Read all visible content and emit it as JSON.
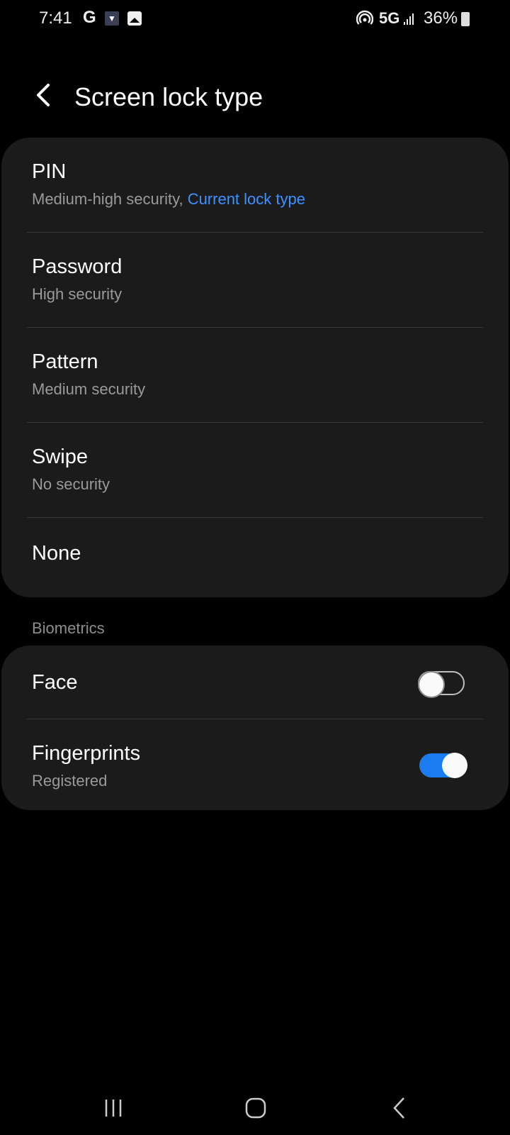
{
  "status_bar": {
    "time": "7:41",
    "google_icon": "G",
    "network": "5G",
    "battery": "36%",
    "icons": [
      "google-icon",
      "shield-icon",
      "gallery-icon",
      "hotspot-icon",
      "5g-icon",
      "signal-icon",
      "battery-charging-icon"
    ]
  },
  "header": {
    "title": "Screen lock type",
    "back_icon": "chevron-left-icon"
  },
  "lock_types": [
    {
      "title": "PIN",
      "subtitle": "Medium-high security,",
      "subtitle_accent": "Current lock type"
    },
    {
      "title": "Password",
      "subtitle": "High security"
    },
    {
      "title": "Pattern",
      "subtitle": "Medium security"
    },
    {
      "title": "Swipe",
      "subtitle": "No security"
    },
    {
      "title": "None"
    }
  ],
  "biometrics": {
    "section_label": "Biometrics",
    "items": [
      {
        "title": "Face",
        "enabled": false
      },
      {
        "title": "Fingerprints",
        "subtitle": "Registered",
        "enabled": true
      }
    ]
  },
  "colors": {
    "accent": "#3e91ff",
    "toggle_on": "#1a7cf0",
    "card_bg": "#1b1b1b",
    "background": "#000000"
  },
  "nav_bar": {
    "recents_icon": "recents-icon",
    "home_icon": "home-icon",
    "back_icon": "back-icon"
  }
}
